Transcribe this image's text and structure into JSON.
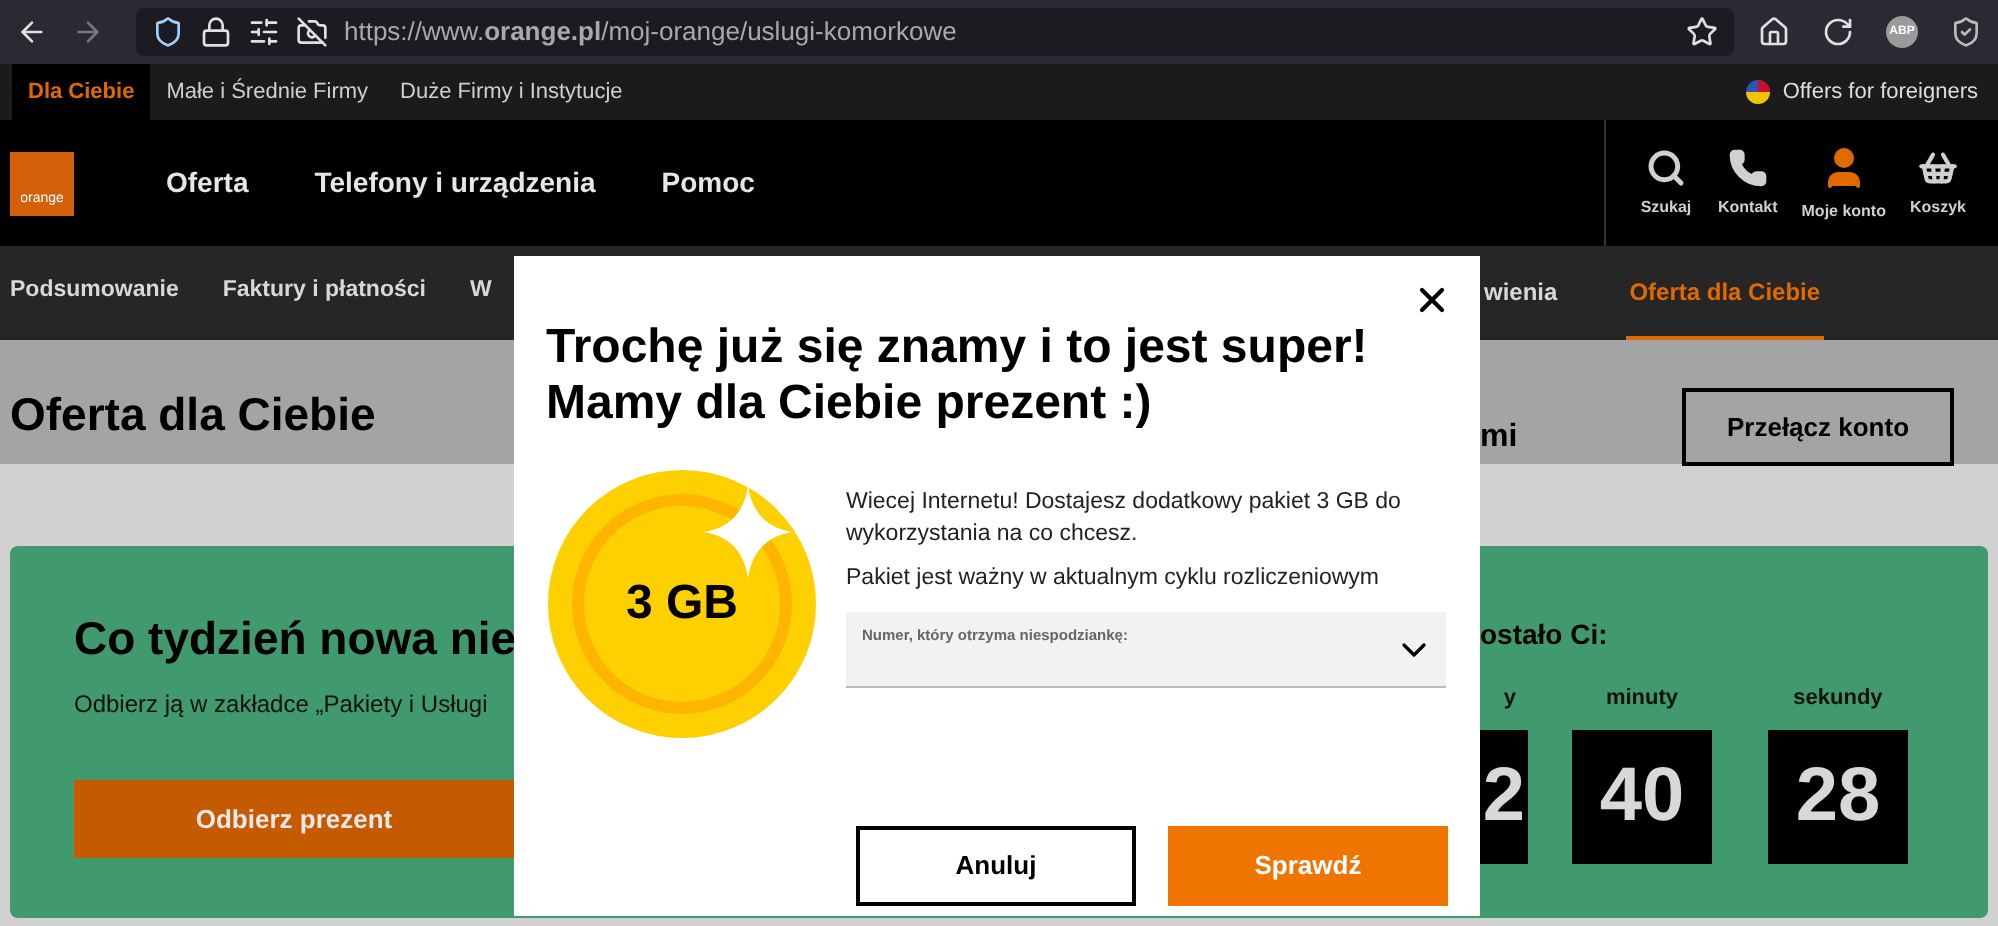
{
  "browser": {
    "url": "https://www.**orange.pl**/moj-orange/uslugi-komorkowe",
    "extension_label": "ABP"
  },
  "segment_tabs": [
    {
      "label": "Dla Ciebie",
      "selected": true
    },
    {
      "label": "Małe i Średnie Firmy",
      "selected": false
    },
    {
      "label": "Duże Firmy i Instytucje",
      "selected": false
    }
  ],
  "foreigners_link": "Offers for foreigners",
  "logo_text": "orange",
  "main_nav": [
    "Oferta",
    "Telefony i urządzenia",
    "Pomoc"
  ],
  "header_actions": [
    {
      "kind": "search",
      "label": "Szukaj"
    },
    {
      "kind": "contact",
      "label": "Kontakt"
    },
    {
      "kind": "account",
      "label": "Moje konto"
    },
    {
      "kind": "basket",
      "label": "Koszyk"
    }
  ],
  "sub_nav_left": [
    {
      "label": "Podsumowanie",
      "selected": false
    },
    {
      "label": "Faktury i płatności",
      "selected": false
    },
    {
      "label": "W",
      "selected": false
    }
  ],
  "sub_nav_right": [
    {
      "label": "wienia",
      "selected": false
    },
    {
      "label": "Oferta dla Ciebie",
      "selected": true
    }
  ],
  "page_title": "Oferta dla Ciebie",
  "page_title_tail": "mi",
  "switch_account_button": "Przełącz konto",
  "promo_card": {
    "heading": "Co tydzień nowa nie",
    "text": "Odbierz ją w zakładce „Pakiety i Usługi",
    "button": "Odbierz prezent",
    "countdown": {
      "heading": "ostało Ci:",
      "units": [
        {
          "kind": "clipped",
          "label": "y",
          "value": "2"
        },
        {
          "kind": "full",
          "label": "minuty",
          "value": "40"
        },
        {
          "kind": "full",
          "label": "sekundy",
          "value": "28"
        }
      ]
    }
  },
  "modal": {
    "title_lines": [
      "Trochę już się znamy i to jest super!",
      "Mamy dla Ciebie prezent :)"
    ],
    "coin_text": "3 GB",
    "description": "Wiecej Internetu! Dostajesz dodatkowy pakiet 3 GB do wykorzystania na co chcesz.",
    "validity": "Pakiet jest ważny w aktualnym cyklu rozliczeniowym",
    "select": {
      "label": "Numer, który otrzyma niespodziankę:"
    },
    "cancel_button": "Anuluj",
    "confirm_button": "Sprawdź"
  }
}
